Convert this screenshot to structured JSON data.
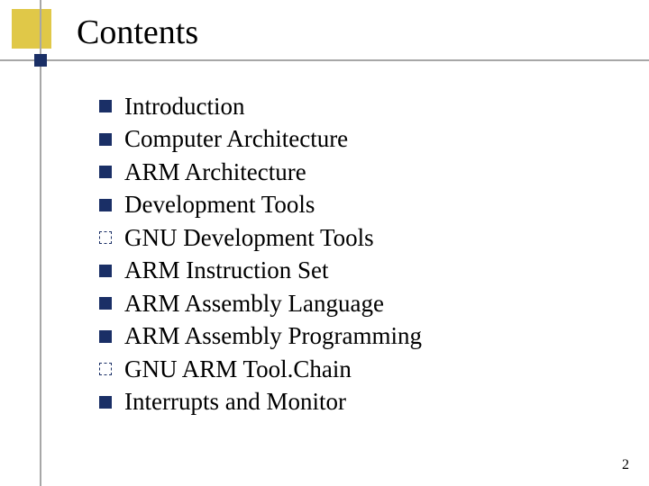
{
  "title": "Contents",
  "items": [
    {
      "label": "Introduction",
      "bullet": "solid"
    },
    {
      "label": "Computer Architecture",
      "bullet": "solid"
    },
    {
      "label": "ARM Architecture",
      "bullet": "solid"
    },
    {
      "label": "Development Tools",
      "bullet": "solid"
    },
    {
      "label": "GNU Development Tools",
      "bullet": "outline"
    },
    {
      "label": "ARM Instruction Set",
      "bullet": "solid"
    },
    {
      "label": "ARM Assembly Language",
      "bullet": "solid"
    },
    {
      "label": "ARM Assembly Programming",
      "bullet": "solid"
    },
    {
      "label": "GNU ARM Tool.Chain",
      "bullet": "outline"
    },
    {
      "label": "Interrupts and Monitor",
      "bullet": "solid"
    }
  ],
  "page_number": "2"
}
